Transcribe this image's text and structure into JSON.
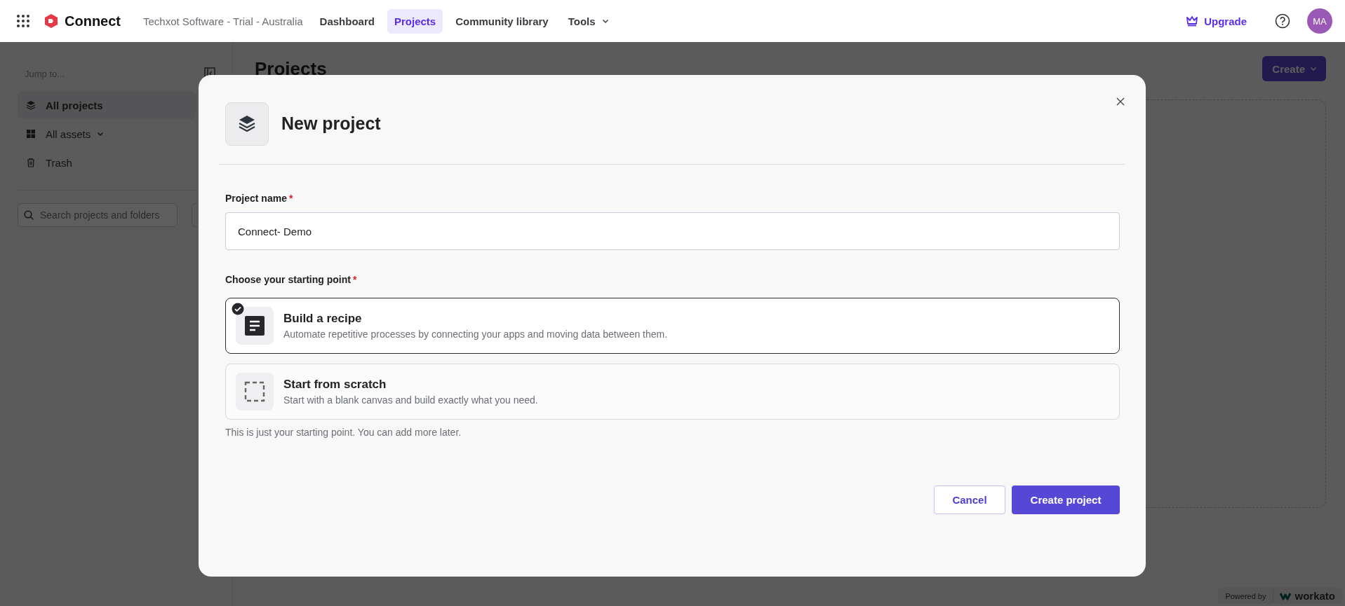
{
  "topbar": {
    "app_name": "Connect",
    "workspace": "Techxot Software - Trial - Australia",
    "nav": [
      {
        "label": "Dashboard",
        "selected": false,
        "kind": "link"
      },
      {
        "label": "Projects",
        "selected": true,
        "kind": "link"
      },
      {
        "label": "Community library",
        "selected": false,
        "kind": "link"
      },
      {
        "label": "Tools",
        "selected": false,
        "kind": "dropdown"
      }
    ],
    "upgrade": "Upgrade",
    "avatar": "MA"
  },
  "sidebar": {
    "heading": "Jump to...",
    "items": [
      {
        "label": "All projects",
        "selected": true,
        "kind": "link"
      },
      {
        "label": "All assets",
        "selected": false,
        "kind": "dropdown"
      },
      {
        "label": "Trash",
        "selected": false,
        "kind": "link"
      }
    ],
    "search": {
      "placeholder": "Search projects and folders"
    }
  },
  "main": {
    "title": "Projects",
    "create_button": "Create"
  },
  "dialog": {
    "title": "New project",
    "project_name": {
      "label": "Project name",
      "required_mark": "*",
      "value": "Connect- Demo"
    },
    "starting_point": {
      "label": "Choose your starting point",
      "required_mark": "*",
      "options": [
        {
          "kind": "recipe",
          "title": "Build a recipe",
          "description": "Automate repetitive processes by connecting your apps and moving data between them.",
          "selected": true
        },
        {
          "kind": "blank",
          "title": "Start from scratch",
          "description": "Start with a blank canvas and build exactly what you need.",
          "selected": false
        }
      ],
      "hint": "This is just your starting point. You can add more later."
    },
    "buttons": {
      "cancel": "Cancel",
      "create": "Create project"
    }
  },
  "footer": {
    "powered_by": "Powered by",
    "brand": "workato"
  }
}
